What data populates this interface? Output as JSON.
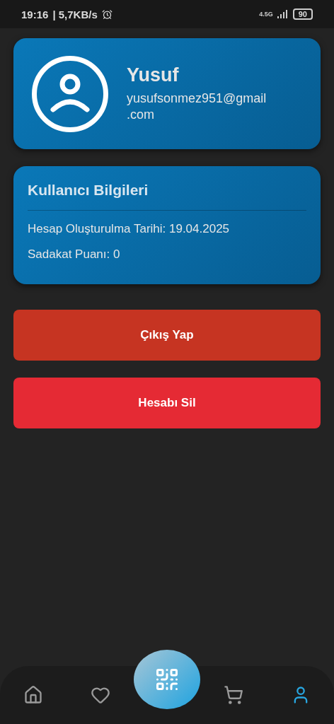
{
  "status_bar": {
    "time": "19:16",
    "speed": "| 5,7KB/s",
    "network": "4.5G",
    "battery": "90"
  },
  "profile": {
    "name": "Yusuf",
    "email": "yusufsonmez951@gmail.com"
  },
  "info_card": {
    "title": "Kullanıcı Bilgileri",
    "lines": [
      "Hesap Oluşturulma Tarihi: 19.04.2025",
      "Sadakat Puanı: 0"
    ]
  },
  "actions": [
    {
      "label": "Çıkış Yap",
      "kind": "logout"
    },
    {
      "label": "Hesabı Sil",
      "kind": "delete"
    }
  ],
  "bottom_nav": [
    {
      "kind": "home",
      "selected": false
    },
    {
      "kind": "favorites",
      "selected": false
    },
    {
      "kind": "scan",
      "selected": false
    },
    {
      "kind": "cart",
      "selected": false
    },
    {
      "kind": "profile",
      "selected": true
    }
  ]
}
